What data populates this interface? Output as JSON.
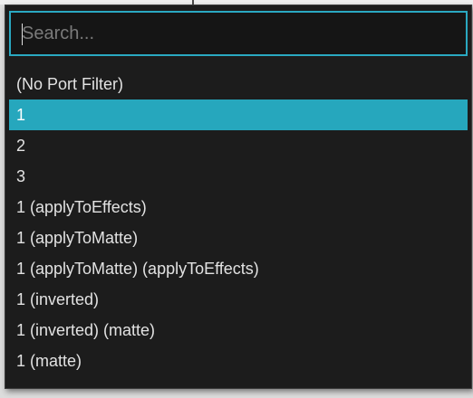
{
  "search": {
    "placeholder": "Search..."
  },
  "colors": {
    "accent": "#26a7bd",
    "panel": "#1c1c1c",
    "text": "#e2e2e2"
  },
  "items": [
    {
      "label": "(No Port Filter)",
      "selected": false
    },
    {
      "label": "1",
      "selected": true
    },
    {
      "label": "2",
      "selected": false
    },
    {
      "label": "3",
      "selected": false
    },
    {
      "label": "1 (applyToEffects)",
      "selected": false
    },
    {
      "label": "1 (applyToMatte)",
      "selected": false
    },
    {
      "label": "1 (applyToMatte) (applyToEffects)",
      "selected": false
    },
    {
      "label": "1 (inverted)",
      "selected": false
    },
    {
      "label": "1 (inverted) (matte)",
      "selected": false
    },
    {
      "label": "1 (matte)",
      "selected": false
    }
  ]
}
